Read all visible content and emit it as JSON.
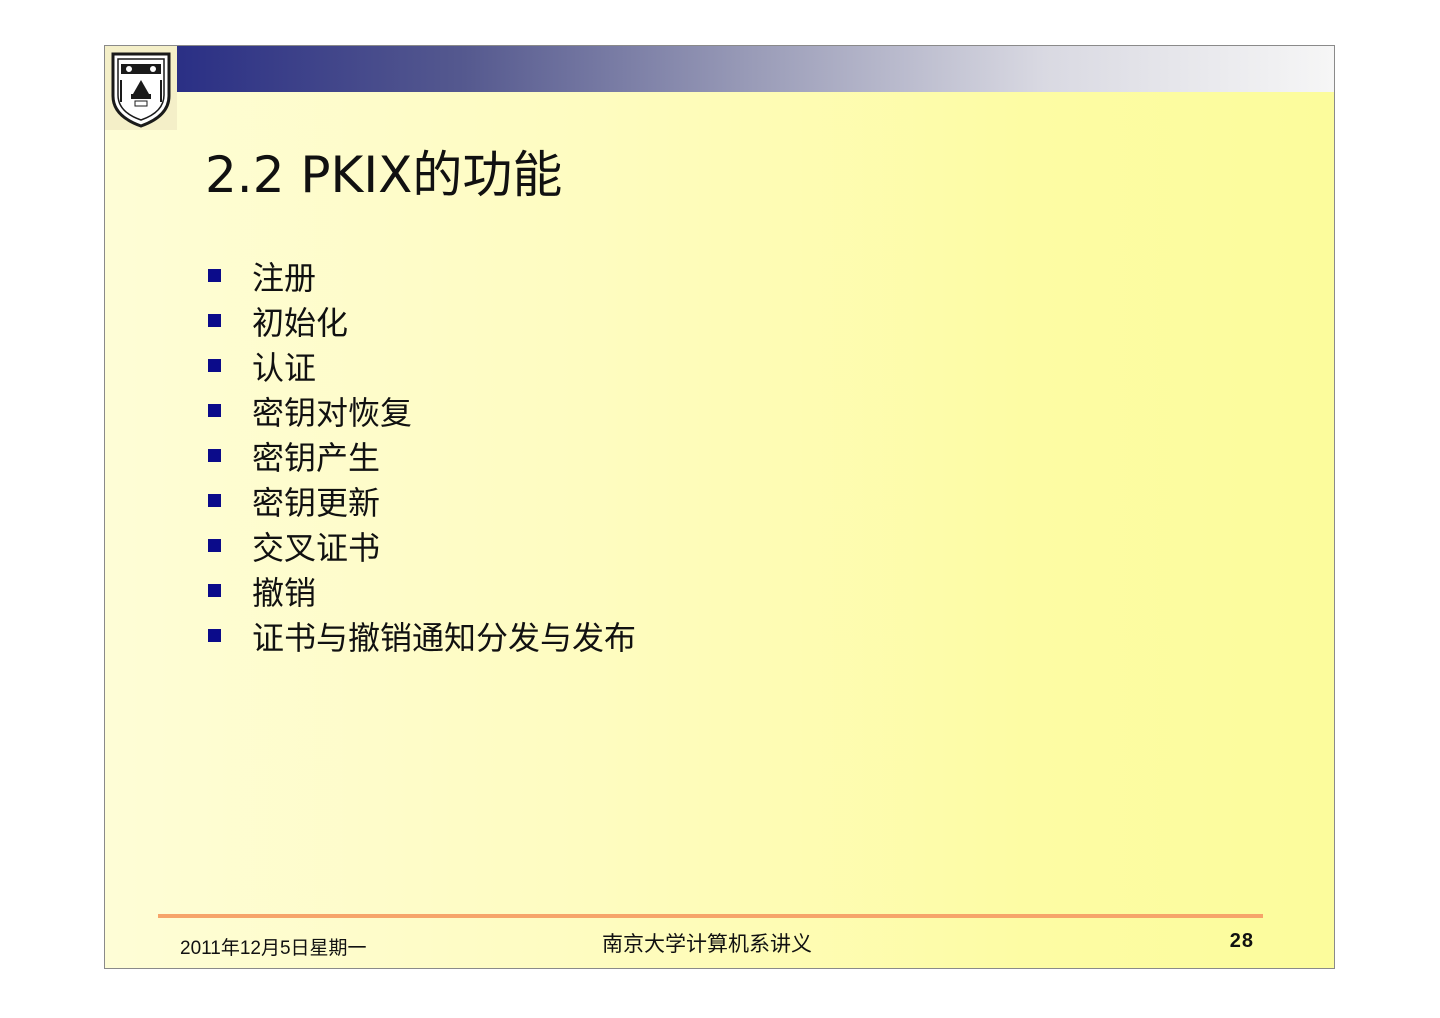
{
  "slide": {
    "title": "2.2 PKIX的功能",
    "bullets": [
      {
        "text": "注册"
      },
      {
        "text": "初始化"
      },
      {
        "text": "认证"
      },
      {
        "text": "密钥对恢复"
      },
      {
        "text": "密钥产生"
      },
      {
        "text": "密钥更新"
      },
      {
        "text": "交叉证书"
      },
      {
        "text": "撤销"
      },
      {
        "text": "证书与撤销通知分发与发布"
      }
    ],
    "footer": {
      "date": "2011年12月5日星期一",
      "center": "南京大学计算机系讲义",
      "page": "28"
    }
  },
  "colors": {
    "bullet": "#0b0b8a",
    "accent_line": "#f6a46a",
    "header_bar_start": "#2a2f85"
  },
  "icons": {
    "logo": "university-seal-icon",
    "bullet": "square-bullet-icon"
  }
}
